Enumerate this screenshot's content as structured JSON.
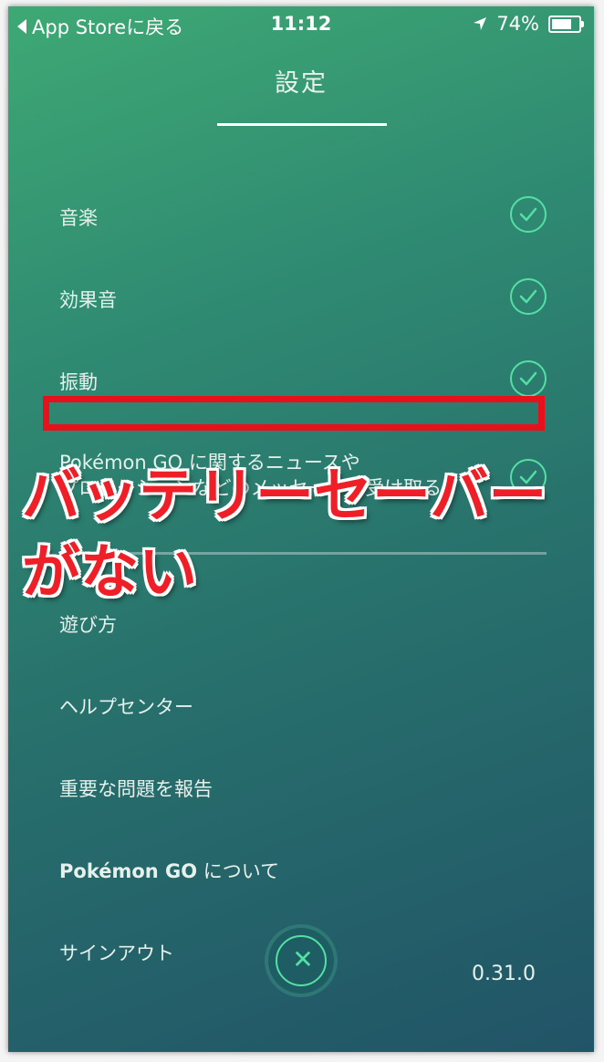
{
  "status_bar": {
    "back_label": "App Storeに戻る",
    "time": "11:12",
    "battery_percent": "74%",
    "battery_level": 0.74
  },
  "header": {
    "title": "設定"
  },
  "toggles": [
    {
      "label": "音楽",
      "checked": true
    },
    {
      "label": "効果音",
      "checked": true
    },
    {
      "label": "振動",
      "checked": true
    },
    {
      "label_line1": "Pokémon GO に関するニュースや",
      "label_line2": "プロモーションなどのメッセージを受け取る",
      "checked": true
    }
  ],
  "menu": [
    {
      "label": "遊び方"
    },
    {
      "label": "ヘルプセンター"
    },
    {
      "label": "重要な問題を報告"
    },
    {
      "label_bold": "Pokémon GO",
      "label_rest": " について"
    },
    {
      "label": "サインアウト"
    }
  ],
  "version": "0.31.0",
  "annotation": {
    "line1": "バッテリーセーバー",
    "line2": "がない"
  },
  "colors": {
    "accent": "#54e0a3",
    "highlight": "#e8101a"
  }
}
